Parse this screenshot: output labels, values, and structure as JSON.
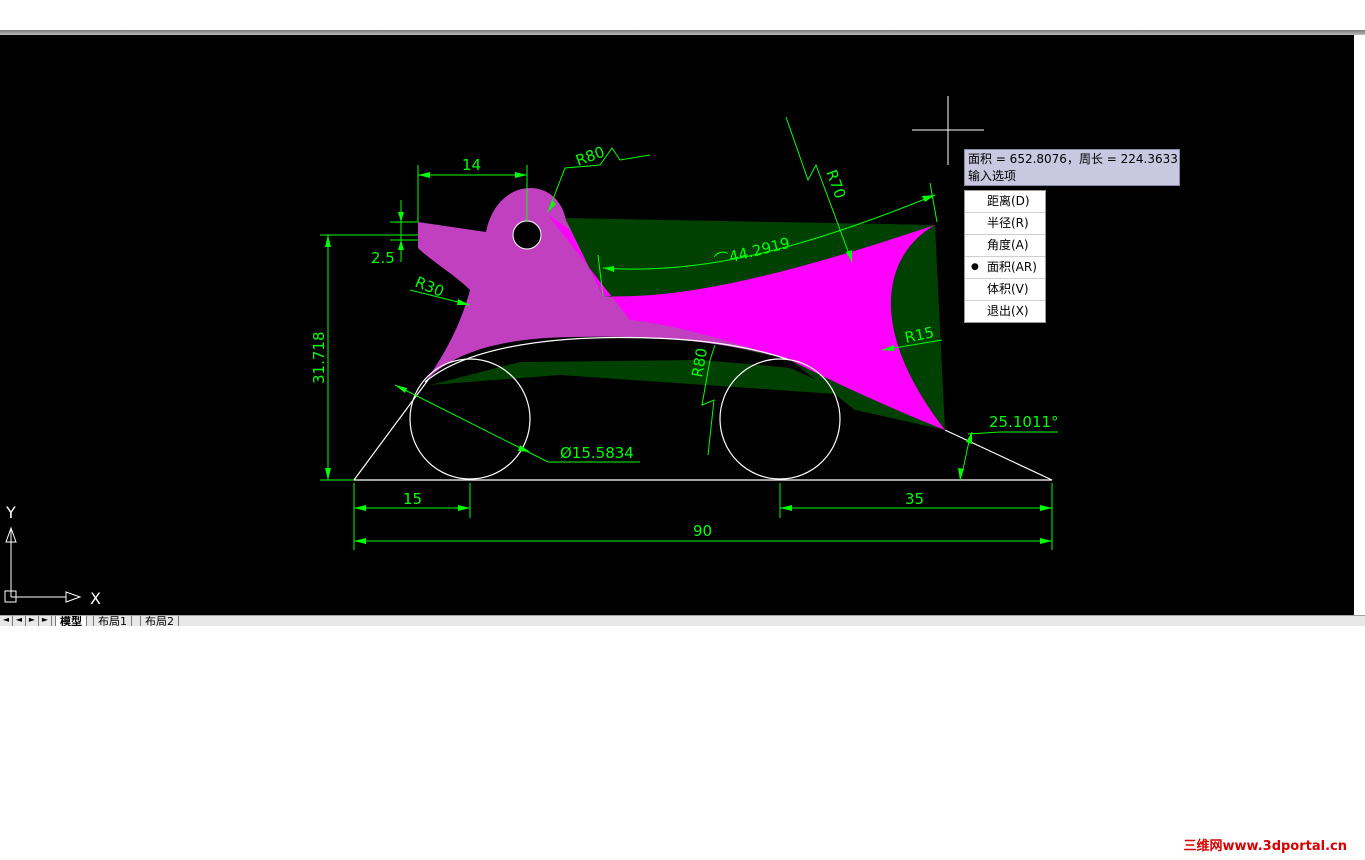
{
  "tooltip": {
    "line1": "面积 = 652.8076，周长 = 224.3633",
    "line2": "输入选项"
  },
  "menu": {
    "items": [
      {
        "label": "距离(D)",
        "selected": false
      },
      {
        "label": "半径(R)",
        "selected": false
      },
      {
        "label": "角度(A)",
        "selected": false
      },
      {
        "label": "面积(AR)",
        "selected": true
      },
      {
        "label": "体积(V)",
        "selected": false
      },
      {
        "label": "退出(X)",
        "selected": false
      }
    ],
    "bullet": "●"
  },
  "dimensions": {
    "d14": "14",
    "d2_5": "2.5",
    "r80_top": "R80",
    "r70": "R70",
    "arc_len": "⌒44.2919",
    "r30": "R30",
    "d31_718": "31.718",
    "r80_bottom": "R80",
    "r15": "R15",
    "diameter": "Ø15.5834",
    "angle": "25.1011°",
    "d15": "15",
    "d35": "35",
    "d90": "90"
  },
  "ucs": {
    "y": "Y",
    "x": "X"
  },
  "tabs": {
    "nav": [
      "◄",
      "◄",
      "►",
      "►"
    ],
    "items": [
      {
        "label": "模型",
        "active": true
      },
      {
        "label": "布局1",
        "active": false
      },
      {
        "label": "布局2",
        "active": false
      }
    ]
  },
  "watermark": "三维网www.3dportal.cn",
  "colors": {
    "canvas": "#000000",
    "dimension": "#00ff00",
    "geometry": "#ffffff",
    "fill_magenta": "#ff00ff",
    "fill_purple": "#c040c0",
    "fill_dark_green": "#004000"
  }
}
